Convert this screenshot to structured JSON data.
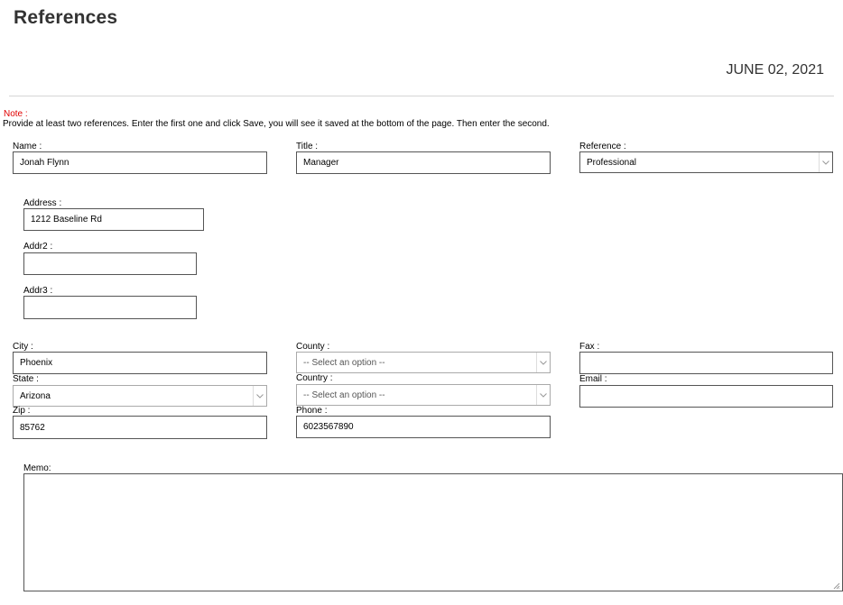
{
  "header": {
    "title": "References",
    "date": "JUNE 02, 2021"
  },
  "note": {
    "label": "Note :",
    "text": "Provide at least two references. Enter the first one and click Save, you will see it saved at the bottom of the page. Then enter the second."
  },
  "form": {
    "name": {
      "label": "Name :",
      "value": "Jonah Flynn"
    },
    "title": {
      "label": "Title :",
      "value": "Manager"
    },
    "reference": {
      "label": "Reference :",
      "value": "Professional"
    },
    "address": {
      "label": "Address :",
      "value": "1212 Baseline Rd"
    },
    "addr2": {
      "label": "Addr2 :",
      "value": ""
    },
    "addr3": {
      "label": "Addr3 :",
      "value": ""
    },
    "city": {
      "label": "City :",
      "value": "Phoenix"
    },
    "county": {
      "label": "County :",
      "value": "-- Select an option --"
    },
    "fax": {
      "label": "Fax :",
      "value": ""
    },
    "state": {
      "label": "State :",
      "value": "Arizona"
    },
    "country": {
      "label": "Country :",
      "value": "-- Select an option --"
    },
    "email": {
      "label": "Email :",
      "value": ""
    },
    "zip": {
      "label": "Zip :",
      "value": "85762"
    },
    "phone": {
      "label": "Phone :",
      "value": "6023567890"
    },
    "memo": {
      "label": "Memo:",
      "value": ""
    }
  },
  "icons": {
    "dropdown": "chevron-down-icon",
    "resize": "resize-grip-icon"
  }
}
